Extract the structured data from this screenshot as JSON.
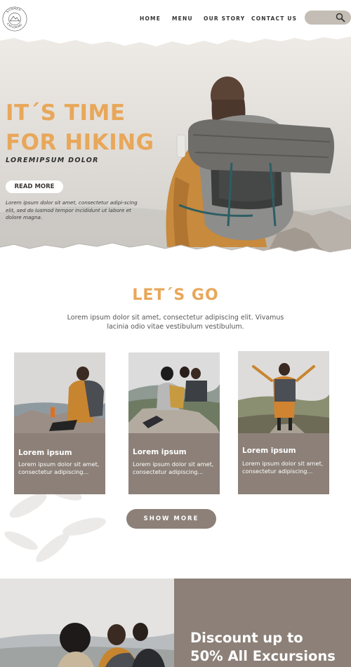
{
  "nav": {
    "logo_text": "SUMMER EXPLORING",
    "links": [
      "HOME",
      "MENU",
      "OUR STORY",
      "CONTACT US"
    ],
    "search_icon": "search-icon"
  },
  "hero": {
    "title_line1": "IT´S TIME",
    "title_line2": "FOR HIKING",
    "subtitle": "LOREMIPSUM DOLOR",
    "button": "READ MORE",
    "text": "Lorem ipsum dolor sit amet, consectetur adipi-scing elit, sed do iusmod tempor incididunt ut labore et dolore magna."
  },
  "intro": {
    "title": "LET´S GO",
    "text": "Lorem ipsum dolor sit amet, consectetur adipiscing elit. Vivamus lacinia odio vitae vestibulum vestibulum."
  },
  "cards": [
    {
      "title": "Lorem ipsum",
      "text": "Lorem ipsum dolor sit amet, consectetur  adipiscing..."
    },
    {
      "title": "Lorem ipsum",
      "text": "Lorem ipsum dolor sit amet, consectetur  adipiscing..."
    },
    {
      "title": "Lorem ipsum",
      "text": "Lorem ipsum dolor sit amet, consectetur  adipiscing..."
    }
  ],
  "show_more": "SHOW MORE",
  "promo": {
    "line1": "Discount up to",
    "line2": "50% All Excursions"
  },
  "colors": {
    "accent": "#e8a75a",
    "taupe": "#8c8078",
    "search_bg": "#c4bdb5"
  }
}
